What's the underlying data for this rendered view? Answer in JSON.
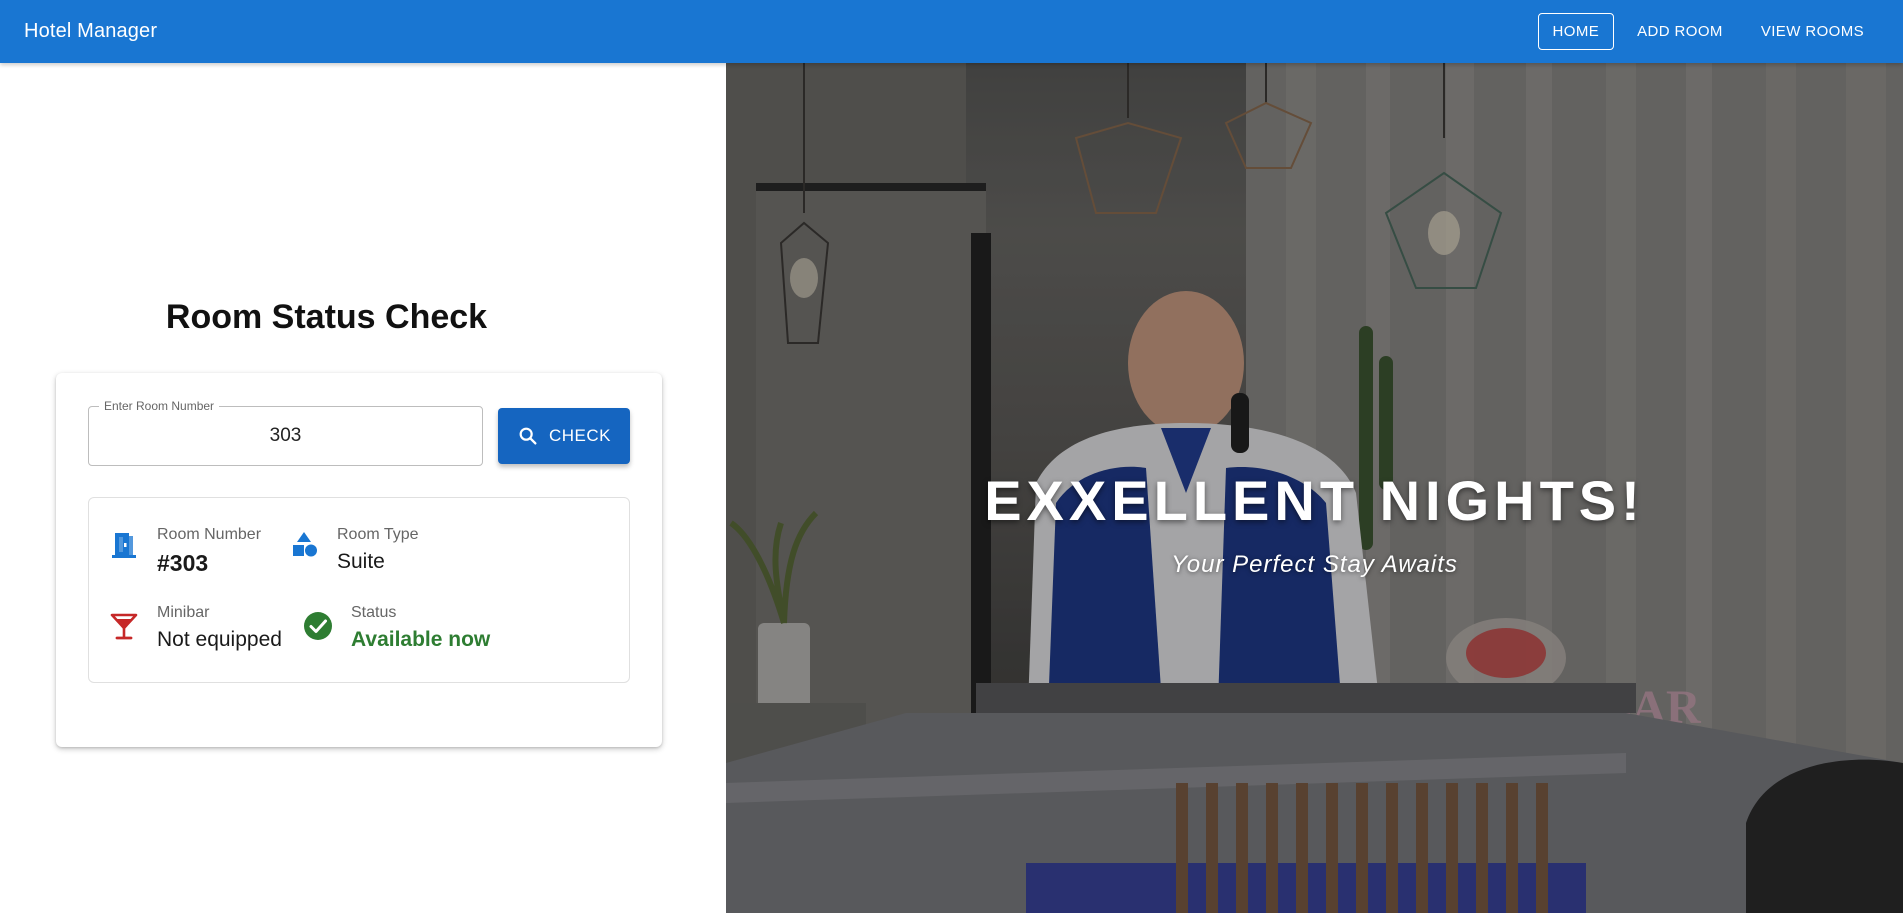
{
  "app": {
    "title": "Hotel Manager"
  },
  "nav": {
    "items": [
      {
        "label": "HOME",
        "active": true
      },
      {
        "label": "ADD ROOM",
        "active": false
      },
      {
        "label": "VIEW ROOMS",
        "active": false
      }
    ]
  },
  "page": {
    "title": "Room Status Check"
  },
  "search": {
    "label": "Enter Room Number",
    "value": "303",
    "button_label": "CHECK"
  },
  "result": {
    "room_number": {
      "label": "Room Number",
      "value": "#303",
      "icon": "door-icon"
    },
    "room_type": {
      "label": "Room Type",
      "value": "Suite",
      "icon": "shapes-icon"
    },
    "minibar": {
      "label": "Minibar",
      "value": "Not equipped",
      "icon": "cocktail-icon"
    },
    "status": {
      "label": "Status",
      "value": "Available now",
      "icon": "check-circle-icon"
    }
  },
  "hero": {
    "title": "EXXELLENT NIGHTS!",
    "subtitle": "Your Perfect Stay Awaits",
    "sign_text": "CANDYBAR"
  },
  "colors": {
    "primary": "#1976d2",
    "button": "#1565c0",
    "success": "#2e7d32",
    "danger": "#c62828"
  }
}
